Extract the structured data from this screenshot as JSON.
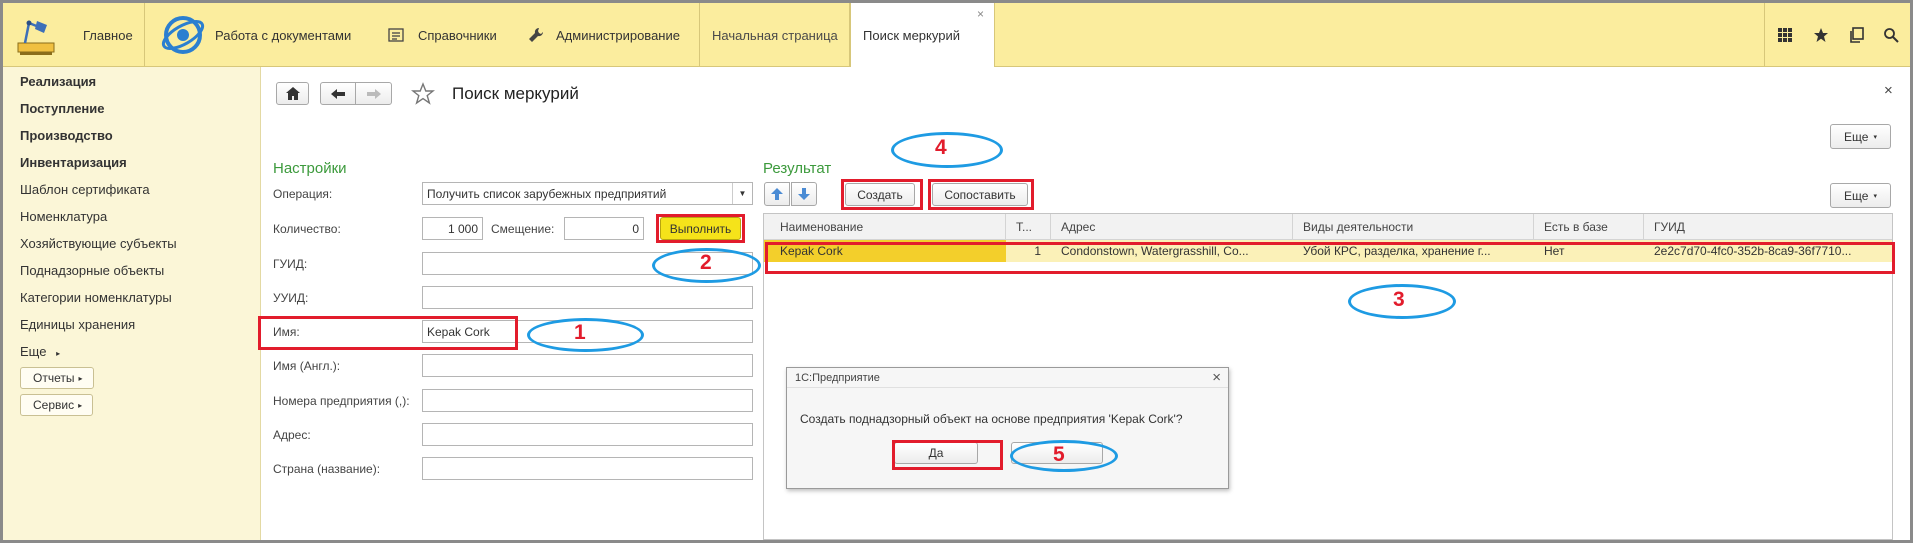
{
  "topbar": {
    "sections": [
      {
        "label": "Главное",
        "icon": "desk-lamp-icon"
      },
      {
        "label": "Работа с документами",
        "icon": "globe-icon"
      },
      {
        "label": "Справочники",
        "icon": "list-icon"
      },
      {
        "label": "Администрирование",
        "icon": "wrench-icon"
      }
    ],
    "tabs": [
      {
        "label": "Начальная страница"
      },
      {
        "label": "Поиск меркурий",
        "close": "×"
      }
    ],
    "icons": [
      "grid-icon",
      "star-icon",
      "history-icon",
      "search-icon"
    ]
  },
  "sidebar": {
    "items": [
      {
        "label": "Реализация",
        "bold": true
      },
      {
        "label": "Поступление",
        "bold": true
      },
      {
        "label": "Производство",
        "bold": true
      },
      {
        "label": "Инвентаризация",
        "bold": true
      },
      {
        "label": "Шаблон сертификата"
      },
      {
        "label": "Номенклатура"
      },
      {
        "label": "Хозяйствующие субъекты"
      },
      {
        "label": "Поднадзорные объекты"
      },
      {
        "label": "Категории номенклатуры"
      },
      {
        "label": "Единицы хранения"
      },
      {
        "label": "Еще"
      }
    ],
    "buttons": [
      {
        "label": "Отчеты"
      },
      {
        "label": "Сервис"
      }
    ]
  },
  "page": {
    "title": "Поиск меркурий",
    "close": "×",
    "more_label": "Еще"
  },
  "settings": {
    "group_label": "Настройки",
    "operation_label": "Операция:",
    "operation_value": "Получить список зарубежных предприятий",
    "count_label": "Количество:",
    "count_value": "1 000",
    "offset_label": "Смещение:",
    "offset_value": "0",
    "run_label": "Выполнить",
    "guid_label": "ГУИД:",
    "uuid_label": "УУИД:",
    "name_label": "Имя:",
    "name_value": "Kepak Cork",
    "name_en_label": "Имя (Англ.):",
    "enterprise_numbers_label": "Номера предприятия (,):",
    "address_label": "Адрес:",
    "country_label": "Страна (название):"
  },
  "result": {
    "group_label": "Результат",
    "create_label": "Создать",
    "compare_label": "Сопоставить",
    "more_label": "Еще",
    "columns": [
      "Наименование",
      "Т...",
      "Адрес",
      "Виды деятельности",
      "Есть в базе",
      "ГУИД"
    ],
    "rows": [
      [
        "Kepak Cork",
        "1",
        "Condonstown, Watergrasshill, Co...",
        "Убой КРС, разделка, хранение г...",
        "Нет",
        "2e2c7d70-4fc0-352b-8ca9-36f7710..."
      ]
    ]
  },
  "dialog": {
    "title": "1С:Предприятие",
    "close": "×",
    "message": "Создать поднадзорный объект на основе предприятия 'Kepak Cork'?",
    "yes_label": "Да"
  },
  "callouts": [
    "1",
    "2",
    "3",
    "4",
    "5"
  ],
  "colors": {
    "topbar": "#fbed9e",
    "sidebar": "#fbf6d7",
    "run_button": "#f5e31a",
    "selected_row": "#fbf1b8",
    "selected_cell": "#f3cf2b",
    "group_label": "#3c9a3c",
    "callout_red": "#e21c2c",
    "callout_blue": "#1e9be3"
  }
}
